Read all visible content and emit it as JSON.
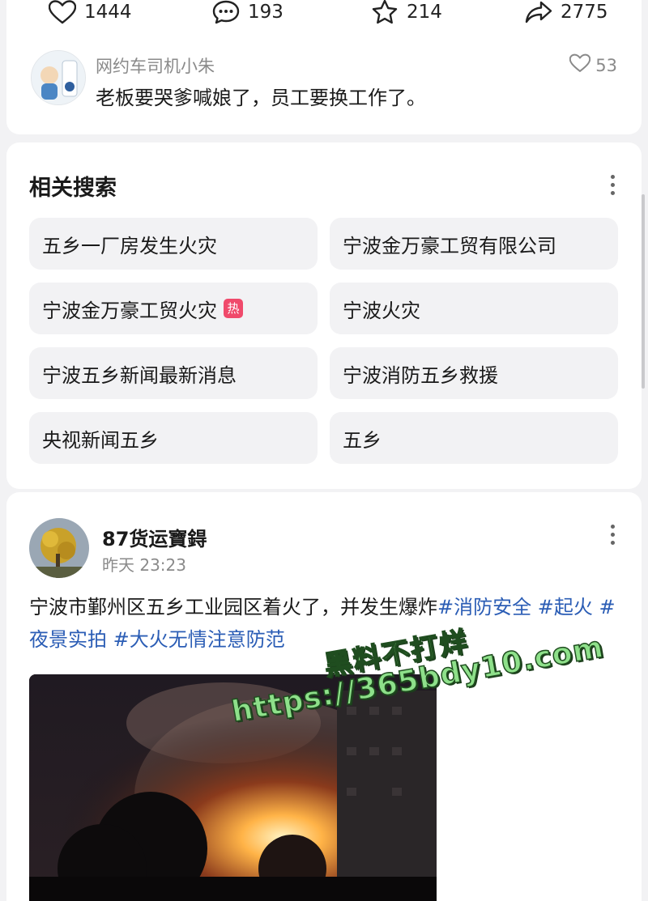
{
  "actions": {
    "likes": "1444",
    "comments": "193",
    "favorites": "214",
    "shares": "2775"
  },
  "comment": {
    "avatar_icon": "avatar-zhu",
    "username": "网约车司机小朱",
    "text": "老板要哭爹喊娘了，员工要换工作了。",
    "likes": "53"
  },
  "related": {
    "title": "相关搜索",
    "items": [
      {
        "label": "五乡一厂房发生火灾",
        "hot": false
      },
      {
        "label": "宁波金万豪工贸有限公司",
        "hot": false
      },
      {
        "label": "宁波金万豪工贸火灾",
        "hot": true,
        "badge": "热"
      },
      {
        "label": "宁波火灾",
        "hot": false
      },
      {
        "label": "宁波五乡新闻最新消息",
        "hot": false
      },
      {
        "label": "宁波消防五乡救援",
        "hot": false
      },
      {
        "label": "央视新闻五乡",
        "hot": false
      },
      {
        "label": "五乡",
        "hot": false
      }
    ]
  },
  "post": {
    "author": "87货运寶鍀",
    "time": "昨天 23:23",
    "text_main": "宁波市鄞州区五乡工业园区着火了，并发生爆炸",
    "tags": [
      "#消防安全",
      "#起火",
      "#夜景实拍",
      "#大火无情注意防范"
    ],
    "media": "fire-night-photo"
  },
  "watermark": {
    "line1": "黑料不打烊",
    "line2": "https://365bdy10.com"
  },
  "colors": {
    "accent_link": "#2b5db5",
    "hot_badge": "#f04a6b",
    "chip_bg": "#f2f2f4"
  }
}
